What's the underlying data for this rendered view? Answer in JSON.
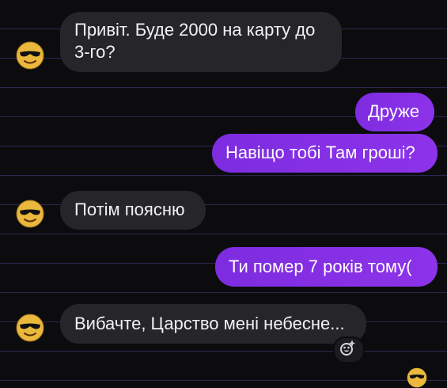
{
  "conversation": {
    "messages": [
      {
        "direction": "incoming",
        "text": "Привіт. Буде 2000 на карту до 3-го?"
      },
      {
        "direction": "outgoing",
        "text": "Друже"
      },
      {
        "direction": "outgoing",
        "text": "Навіщо тобі Там гроші?"
      },
      {
        "direction": "incoming",
        "text": "Потім поясню"
      },
      {
        "direction": "outgoing",
        "text": "Ти помер 7 років тому("
      },
      {
        "direction": "incoming",
        "text": "Вибачте, Царство мені небесне..."
      }
    ],
    "msg1_line1": "Привіт. Буде 2000 на карту до",
    "msg1_line2": "3-го?"
  },
  "icons": {
    "avatar": "sunglasses-emoji-avatar-icon",
    "reaction": "add-reaction-icon",
    "seen": "seen-avatar-icon"
  },
  "colors": {
    "background": "#0c0c0e",
    "incoming_bubble": "#262628",
    "outgoing_bubble": "#8a2be2",
    "text": "#f2f2f4"
  }
}
